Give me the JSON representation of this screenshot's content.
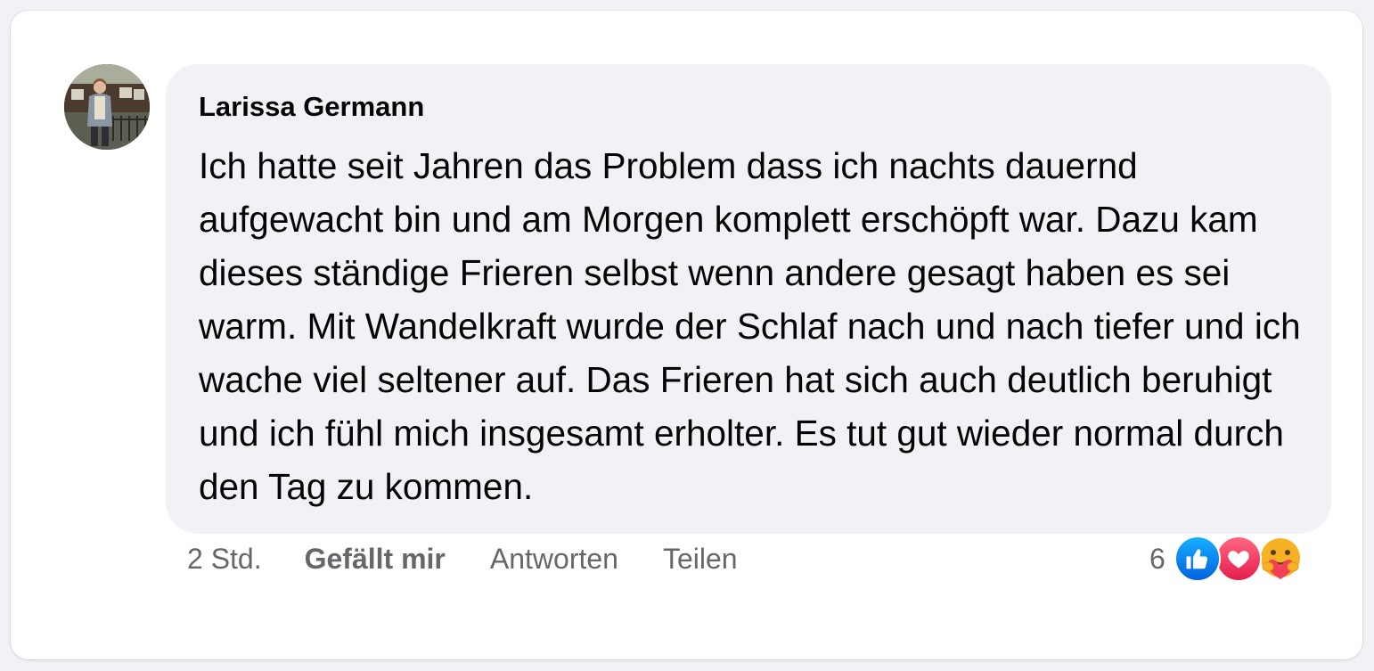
{
  "comment": {
    "author": "Larissa Germann",
    "text": "Ich hatte seit Jahren das Problem dass ich nachts dauernd aufgewacht bin und am Morgen komplett erschöpft war. Dazu kam dieses ständige Frieren selbst wenn andere gesagt haben es sei warm. Mit Wandelkraft wurde der Schlaf nach und nach tiefer und ich wache viel seltener auf. Das Frieren hat sich auch deutlich beruhigt und ich fühl mich insgesamt erholter. Es tut gut wieder normal durch den Tag zu kommen."
  },
  "actions": {
    "timestamp": "2 Std.",
    "like_label": "Gefällt mir",
    "reply_label": "Antworten",
    "share_label": "Teilen"
  },
  "reactions": {
    "count": "6",
    "icons": [
      "like-icon",
      "love-icon",
      "care-icon"
    ]
  },
  "colors": {
    "bubble": "#f0f2f5",
    "meta_text": "#65676b",
    "like_blue": "#0866ff",
    "love_red": "#f33e58",
    "care_yellow": "#f7b125"
  }
}
